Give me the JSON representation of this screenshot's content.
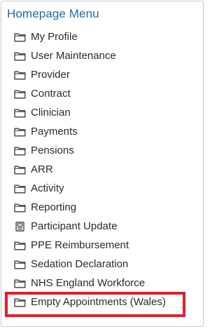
{
  "menu": {
    "title": "Homepage Menu",
    "items": [
      {
        "label": "My Profile",
        "icon": "folder-icon"
      },
      {
        "label": "User Maintenance",
        "icon": "folder-icon"
      },
      {
        "label": "Provider",
        "icon": "folder-icon"
      },
      {
        "label": "Contract",
        "icon": "folder-icon"
      },
      {
        "label": "Clinician",
        "icon": "folder-icon"
      },
      {
        "label": "Payments",
        "icon": "folder-icon"
      },
      {
        "label": "Pensions",
        "icon": "folder-icon"
      },
      {
        "label": "ARR",
        "icon": "folder-icon"
      },
      {
        "label": "Activity",
        "icon": "folder-icon"
      },
      {
        "label": "Reporting",
        "icon": "folder-icon"
      },
      {
        "label": "Participant Update",
        "icon": "id-card-icon"
      },
      {
        "label": "PPE Reimbursement",
        "icon": "folder-icon"
      },
      {
        "label": "Sedation Declaration",
        "icon": "folder-icon"
      },
      {
        "label": "NHS England Workforce",
        "icon": "folder-icon"
      },
      {
        "label": "Empty Appointments (Wales)",
        "icon": "folder-icon"
      }
    ]
  },
  "colors": {
    "title": "#1f6aa8",
    "highlight_border": "#e0202b"
  }
}
